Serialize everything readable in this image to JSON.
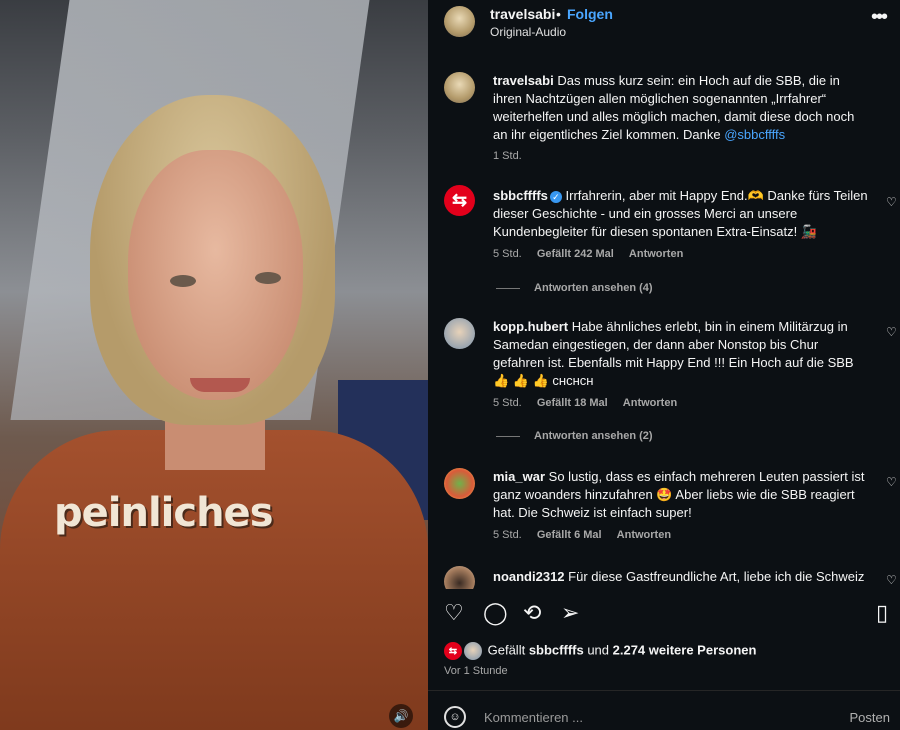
{
  "video": {
    "overlay_word": "peinliches",
    "sound_icon": "speaker-icon"
  },
  "header": {
    "username": "travelsabi",
    "separator": "•",
    "follow_label": "Folgen",
    "audio_label": "Original-Audio",
    "more_icon": "more-icon"
  },
  "caption": {
    "username": "travelsabi",
    "text": "Das muss kurz sein: ein Hoch auf die SBB, die in ihren Nachtzügen allen möglichen sogenannten „Irrfahrer“ weiterhelfen und alles möglich machen, damit diese doch noch an ihr eigentliches Ziel kommen. Danke ",
    "mention": "@sbbcffffs",
    "time": "1 Std."
  },
  "comments": [
    {
      "username": "sbbcffffs",
      "text": "Irrfahrerin, aber mit Happy End.🫶 Danke fürs Teilen dieser Geschichte - und ein grosses Merci an unsere Kundenbegleiter für diesen spontanen Extra-Einsatz! 🚂",
      "time": "5 Std.",
      "likes": "Gefällt 242 Mal",
      "reply_label": "Antworten",
      "view_replies": "Antworten ansehen (4)"
    },
    {
      "username": "kopp.hubert",
      "text": "Habe ähnliches erlebt, bin in einem Militärzug in Samedan eingestiegen, der dann aber Nonstop bis Chur gefahren ist. Ebenfalls mit Happy End !!! Ein Hoch auf die SBB 👍 👍 👍 ᴄʜᴄʜᴄʜ",
      "time": "5 Std.",
      "likes": "Gefällt 18 Mal",
      "reply_label": "Antworten",
      "view_replies": "Antworten ansehen (2)"
    },
    {
      "username": "mia_war",
      "text": "So lustig, dass es einfach mehreren Leuten passiert ist ganz woanders hinzufahren 🤩 Aber liebs wie die SBB reagiert hat. Die Schweiz ist einfach super!",
      "time": "5 Std.",
      "likes": "Gefällt 6 Mal",
      "reply_label": "Antworten"
    },
    {
      "username": "noandi2312",
      "text": "Für diese Gastfreundliche Art, liebe ich die Schweiz"
    }
  ],
  "likes_summary": {
    "prefix": "Gefällt ",
    "user": "sbbcffffs",
    "middle": " und ",
    "count": "2.274 weitere Personen"
  },
  "post_time": "Vor 1 Stunde",
  "composer": {
    "placeholder": "Kommentieren ...",
    "post_label": "Posten"
  }
}
